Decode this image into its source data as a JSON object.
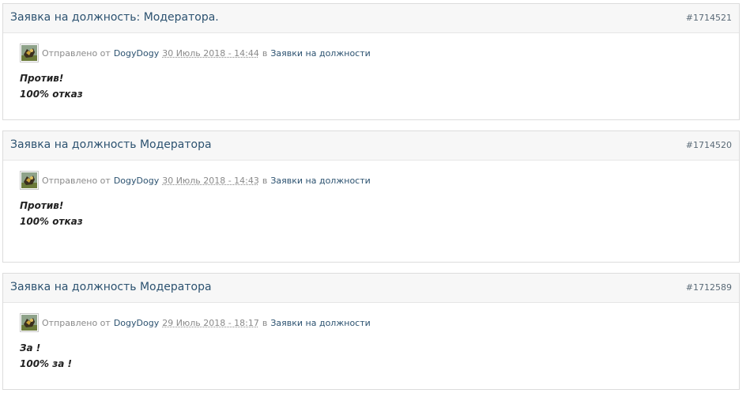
{
  "posts": [
    {
      "title": "Заявка на должность: Модератора.",
      "number": "#1714521",
      "meta": {
        "sent_prefix": "Отправлено от",
        "author": "DogyDogy",
        "date": "30 Июль 2018 - 14:44",
        "in_word": "в",
        "forum": "Заявки на должности"
      },
      "lines": [
        "Против!",
        "100% отказ"
      ]
    },
    {
      "title": "Заявка на должность Модератора",
      "number": "#1714520",
      "meta": {
        "sent_prefix": "Отправлено от",
        "author": "DogyDogy",
        "date": "30 Июль 2018 - 14:43",
        "in_word": "в",
        "forum": "Заявки на должности"
      },
      "lines": [
        "Против!",
        "100% отказ"
      ]
    },
    {
      "title": "Заявка на должность Модератора",
      "number": "#1712589",
      "meta": {
        "sent_prefix": "Отправлено от",
        "author": "DogyDogy",
        "date": "29 Июль 2018 - 18:17",
        "in_word": "в",
        "forum": "Заявки на должности"
      },
      "lines": [
        "За !",
        "100% за !"
      ]
    }
  ],
  "colors": {
    "link": "#2c5270",
    "meta_gray": "#8a8a8a",
    "header_bg": "#f7f7f7",
    "border": "#dcdcdc"
  },
  "icons": {
    "avatar": "user-avatar-icon"
  }
}
